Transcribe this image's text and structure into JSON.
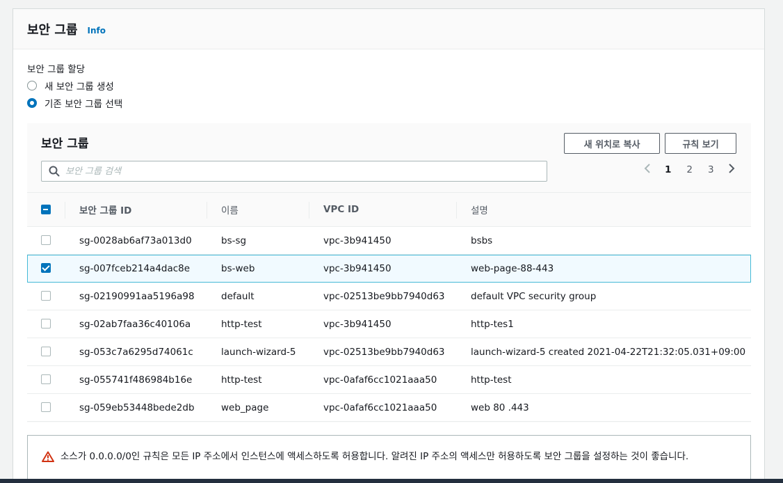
{
  "panel": {
    "title": "보안 그룹",
    "info": "Info"
  },
  "assign": {
    "label": "보안 그룹 할당",
    "options": [
      {
        "label": "새 보안 그룹 생성",
        "selected": false
      },
      {
        "label": "기존 보안 그룹 선택",
        "selected": true
      }
    ]
  },
  "sg": {
    "title": "보안 그룹",
    "copy_button": "새 위치로 복사",
    "rules_button": "규칙 보기",
    "search_placeholder": "보안 그룹 검색",
    "pages": [
      "1",
      "2",
      "3"
    ],
    "current_page": "1",
    "columns": [
      "보안 그룹 ID",
      "이름",
      "VPC ID",
      "설명"
    ],
    "rows": [
      {
        "id": "sg-0028ab6af73a013d0",
        "name": "bs-sg",
        "vpc": "vpc-3b941450",
        "desc": "bsbs",
        "checked": false
      },
      {
        "id": "sg-007fceb214a4dac8e",
        "name": "bs-web",
        "vpc": "vpc-3b941450",
        "desc": "web-page-88-443",
        "checked": true
      },
      {
        "id": "sg-02190991aa5196a98",
        "name": "default",
        "vpc": "vpc-02513be9bb7940d63",
        "desc": "default VPC security group",
        "checked": false
      },
      {
        "id": "sg-02ab7faa36c40106a",
        "name": "http-test",
        "vpc": "vpc-3b941450",
        "desc": "http-tes1",
        "checked": false
      },
      {
        "id": "sg-053c7a6295d74061c",
        "name": "launch-wizard-5",
        "vpc": "vpc-02513be9bb7940d63",
        "desc": "launch-wizard-5 created 2021-04-22T21:32:05.031+09:00",
        "checked": false
      },
      {
        "id": "sg-055741f486984b16e",
        "name": "http-test",
        "vpc": "vpc-0afaf6cc1021aaa50",
        "desc": "http-test",
        "checked": false
      },
      {
        "id": "sg-059eb53448bede2db",
        "name": "web_page",
        "vpc": "vpc-0afaf6cc1021aaa50",
        "desc": "web 80 .443",
        "checked": false
      }
    ]
  },
  "warning": {
    "icon": "warning-triangle-icon",
    "text": "소스가 0.0.0.0/0인 규칙은 모든 IP 주소에서 인스턴스에 액세스하도록 허용합니다. 알려진 IP 주소의 액세스만 허용하도록 보안 그룹을 설정하는 것이 좋습니다."
  },
  "colors": {
    "accent": "#0073bb",
    "selected_row_bg": "#f1faff",
    "selected_row_border": "#44b9d6",
    "warning": "#d13212"
  }
}
